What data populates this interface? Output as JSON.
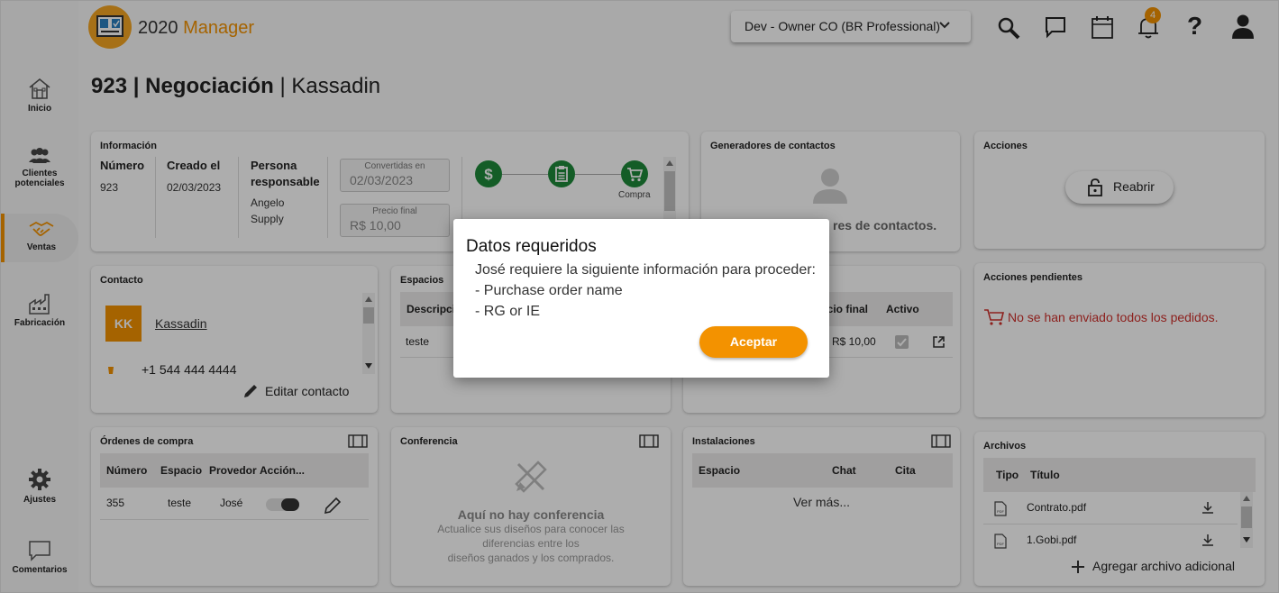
{
  "app": {
    "logo_number": "2020",
    "logo_name": "Manager",
    "org_selector": "Dev - Owner CO (BR Professional)",
    "notifications_count": "4"
  },
  "sidebar": {
    "items": [
      {
        "label": "Inicio"
      },
      {
        "label": "Clientes potenciales"
      },
      {
        "label": "Ventas"
      },
      {
        "label": "Fabricación"
      },
      {
        "label": "Ajustes"
      },
      {
        "label": "Comentarios"
      }
    ]
  },
  "page": {
    "number": "923",
    "separator": "|",
    "stage": "Negociación",
    "client": "Kassadin"
  },
  "info": {
    "title": "Información",
    "numero_label": "Número",
    "numero": "923",
    "creado_label": "Creado el",
    "creado": "02/03/2023",
    "persona_label_1": "Persona",
    "persona_label_2": "responsable",
    "persona_1": "Angelo",
    "persona_2": "Supply",
    "convertidas_label": "Convertidas en",
    "convertidas": "02/03/2023",
    "precio_label": "Precio final",
    "precio": "R$ 10,00",
    "step_label": "Compra"
  },
  "generadores": {
    "title": "Generadores de contactos",
    "text_partial": "res de contactos."
  },
  "acciones": {
    "title": "Acciones",
    "reabrir": "Reabrir"
  },
  "contacto": {
    "title": "Contacto",
    "initials": "KK",
    "name": "Kassadin",
    "phone": "+1 544 444 4444",
    "edit": "Editar contacto"
  },
  "espacios": {
    "title": "Espacios",
    "col_desc": "Descripci",
    "row_desc": "teste"
  },
  "hidden_table": {
    "col_precio": "ecio final",
    "col_activo": "Activo",
    "row_precio": "R$ 10,00"
  },
  "pendientes": {
    "title": "Acciones pendientes",
    "message": "No se han enviado todos los pedidos."
  },
  "ordenes": {
    "title": "Órdenes de compra",
    "columns": [
      "Número",
      "Espacio",
      "Provedor",
      "Acción..."
    ],
    "row": {
      "numero": "355",
      "espacio": "teste",
      "provedor": "José"
    }
  },
  "conferencia": {
    "title": "Conferencia",
    "empty_title": "Aquí no hay conferencia",
    "empty_1": "Actualice sus diseños para conocer las",
    "empty_2": "diferencias entre los",
    "empty_3": "diseños ganados y los comprados."
  },
  "instalaciones": {
    "title": "Instalaciones",
    "columns": [
      "Espacio",
      "Chat",
      "Cita"
    ],
    "more": "Ver más..."
  },
  "archivos": {
    "title": "Archivos",
    "col_tipo": "Tipo",
    "col_titulo": "Título",
    "files": [
      "Contrato.pdf",
      "1.Gobi.pdf"
    ],
    "add": "Agregar archivo adicional"
  },
  "modal": {
    "title": "Datos requeridos",
    "line1": "José requiere la siguiente información para proceder:",
    "line2": "- Purchase order name",
    "line3": "- RG or IE",
    "accept": "Aceptar"
  },
  "colors": {
    "accent": "#f39200",
    "green": "#1e8a3a",
    "alert": "#d0312d"
  }
}
